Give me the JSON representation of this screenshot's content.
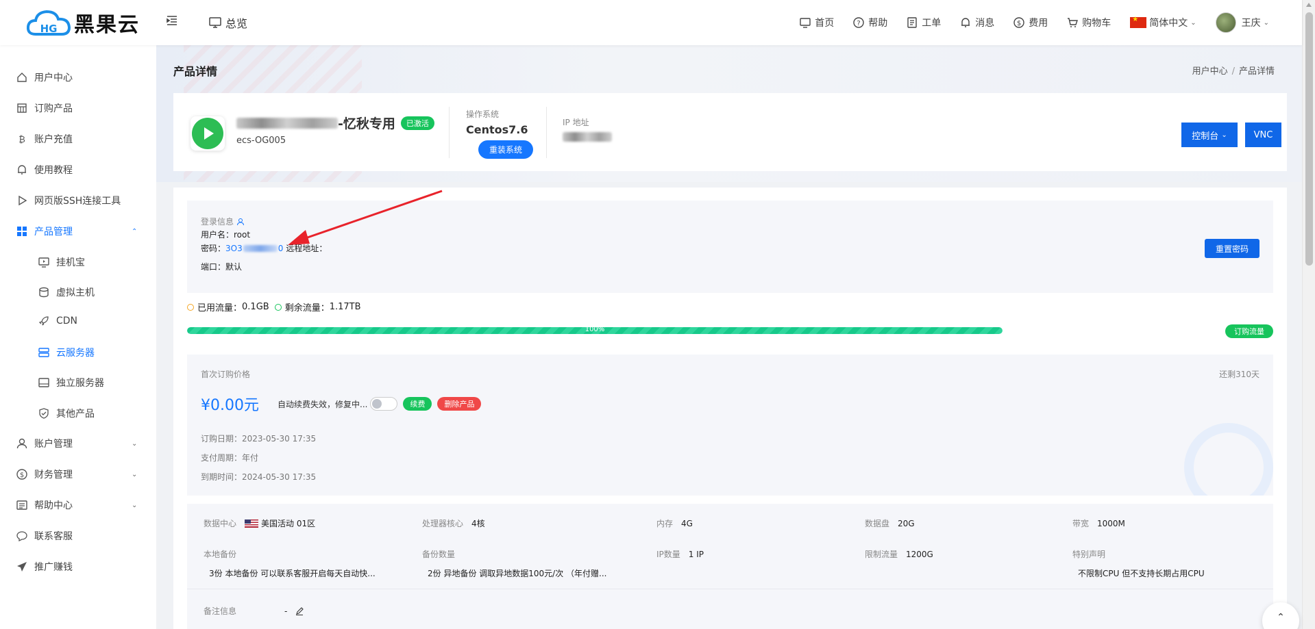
{
  "brand": {
    "logo_text": "黑果云",
    "logo_badge": "HG"
  },
  "header": {
    "overview": "总览",
    "nav": [
      {
        "label": "首页",
        "icon": "home-screen-icon"
      },
      {
        "label": "帮助",
        "icon": "help-circle-icon"
      },
      {
        "label": "工单",
        "icon": "ticket-icon"
      },
      {
        "label": "消息",
        "icon": "bell-icon"
      },
      {
        "label": "费用",
        "icon": "dollar-circle-icon"
      },
      {
        "label": "购物车",
        "icon": "cart-icon"
      }
    ],
    "language": "简体中文",
    "user": "王庆"
  },
  "sidebar": {
    "items": [
      {
        "label": "用户中心",
        "icon": "home-icon"
      },
      {
        "label": "订购产品",
        "icon": "shop-icon"
      },
      {
        "label": "账户充值",
        "icon": "bitcoin-icon"
      },
      {
        "label": "使用教程",
        "icon": "bell-icon"
      },
      {
        "label": "网页版SSH连接工具",
        "icon": "play-icon"
      },
      {
        "label": "产品管理",
        "icon": "grid-icon"
      },
      {
        "label": "账户管理",
        "icon": "user-icon"
      },
      {
        "label": "财务管理",
        "icon": "dollar-circle-icon"
      },
      {
        "label": "帮助中心",
        "icon": "doc-icon"
      },
      {
        "label": "联系客服",
        "icon": "chat-icon"
      },
      {
        "label": "推广赚钱",
        "icon": "send-icon"
      }
    ],
    "sub_items": [
      {
        "label": "挂机宝",
        "icon": "monitor-play-icon"
      },
      {
        "label": "虚拟主机",
        "icon": "database-icon"
      },
      {
        "label": "CDN",
        "icon": "rocket-icon"
      },
      {
        "label": "云服务器",
        "icon": "server-icon"
      },
      {
        "label": "独立服务器",
        "icon": "drive-icon"
      },
      {
        "label": "其他产品",
        "icon": "shield-icon"
      }
    ]
  },
  "page": {
    "title": "产品详情",
    "breadcrumb": [
      "用户中心",
      "产品详情"
    ]
  },
  "product": {
    "name_suffix": "-忆秋专用",
    "status": "已激活",
    "id": "ecs-OG005",
    "os_label": "操作系统",
    "os_value": "Centos7.6",
    "reinstall": "重装系统",
    "ip_label": "IP 地址",
    "console": "控制台",
    "vnc": "VNC"
  },
  "login": {
    "title": "登录信息",
    "username_label": "用户名：",
    "username": "root",
    "password_label": "密码：",
    "password_visible": "3O3",
    "password_tail": "0",
    "remote_label": "远程地址：",
    "port_label": "端口：",
    "port_value": "默认",
    "reset": "重置密码"
  },
  "traffic": {
    "used_label": "已用流量：",
    "used": "0.1GB",
    "remain_label": "剩余流量：",
    "remain": "1.17TB",
    "percent_label": "100%",
    "buy": "订购流量"
  },
  "billing": {
    "first_price_label": "首次订购价格",
    "remaining_days": "还剩310天",
    "price": "¥0.00元",
    "auto_renew": "自动续费失效，修复中...",
    "renew": "续费",
    "delete": "删除产品",
    "order_date_label": "订购日期：",
    "order_date": "2023-05-30 17:35",
    "cycle_label": "支付周期：",
    "cycle": "年付",
    "expire_label": "到期时间：",
    "expire": "2024-05-30 17:35"
  },
  "specs": {
    "datacenter_label": "数据中心",
    "datacenter": "美国活动 01区",
    "cpu_label": "处理器核心",
    "cpu": "4核",
    "memory_label": "内存",
    "memory": "4G",
    "disk_label": "数据盘",
    "disk": "20G",
    "bandwidth_label": "带宽",
    "bandwidth": "1000M",
    "local_backup_label": "本地备份",
    "local_backup": "3份 本地备份 可以联系客服开启每天自动快...",
    "backup_count_label": "备份数量",
    "backup_count": "2份 异地备份 调取异地数据100元/次 （年付赠...",
    "ip_count_label": "IP数量",
    "ip_count": "1 IP",
    "traffic_limit_label": "限制流量",
    "traffic_limit": "1200G",
    "special_label": "特别声明",
    "special": "不限制CPU 但不支持长期占用CPU",
    "note_label": "备注信息",
    "note": "-"
  },
  "colors": {
    "primary": "#1677ff",
    "success": "#17c45c",
    "danger": "#f04848",
    "annotation": "#e8232b"
  }
}
